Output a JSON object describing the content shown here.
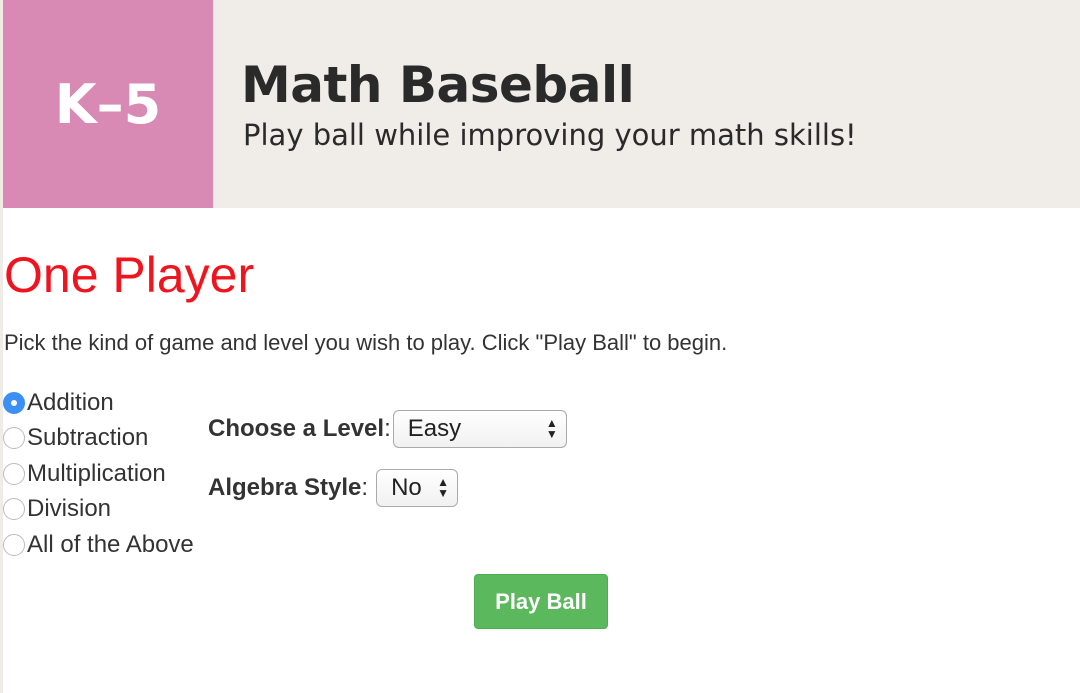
{
  "header": {
    "logo": "K–5",
    "title": "Math Baseball",
    "subtitle": "Play ball while improving your math skills!"
  },
  "main": {
    "heading": "One Player",
    "intro": "Pick the kind of game and level you wish to play. Click \"Play Ball\" to begin.",
    "game_types": [
      {
        "label": "Addition",
        "selected": true
      },
      {
        "label": "Subtraction",
        "selected": false
      },
      {
        "label": "Multiplication",
        "selected": false
      },
      {
        "label": "Division",
        "selected": false
      },
      {
        "label": "All of the Above",
        "selected": false
      }
    ],
    "level": {
      "label": "Choose a Level",
      "value": "Easy"
    },
    "algebra": {
      "label": "Algebra Style",
      "value": "No"
    },
    "play_button": "Play Ball"
  },
  "colors": {
    "logo_bg": "#d98ab4",
    "header_bg": "#f0ece7",
    "heading": "#f0141e",
    "button": "#5cb85c",
    "radio_selected": "#3b8ff5"
  }
}
